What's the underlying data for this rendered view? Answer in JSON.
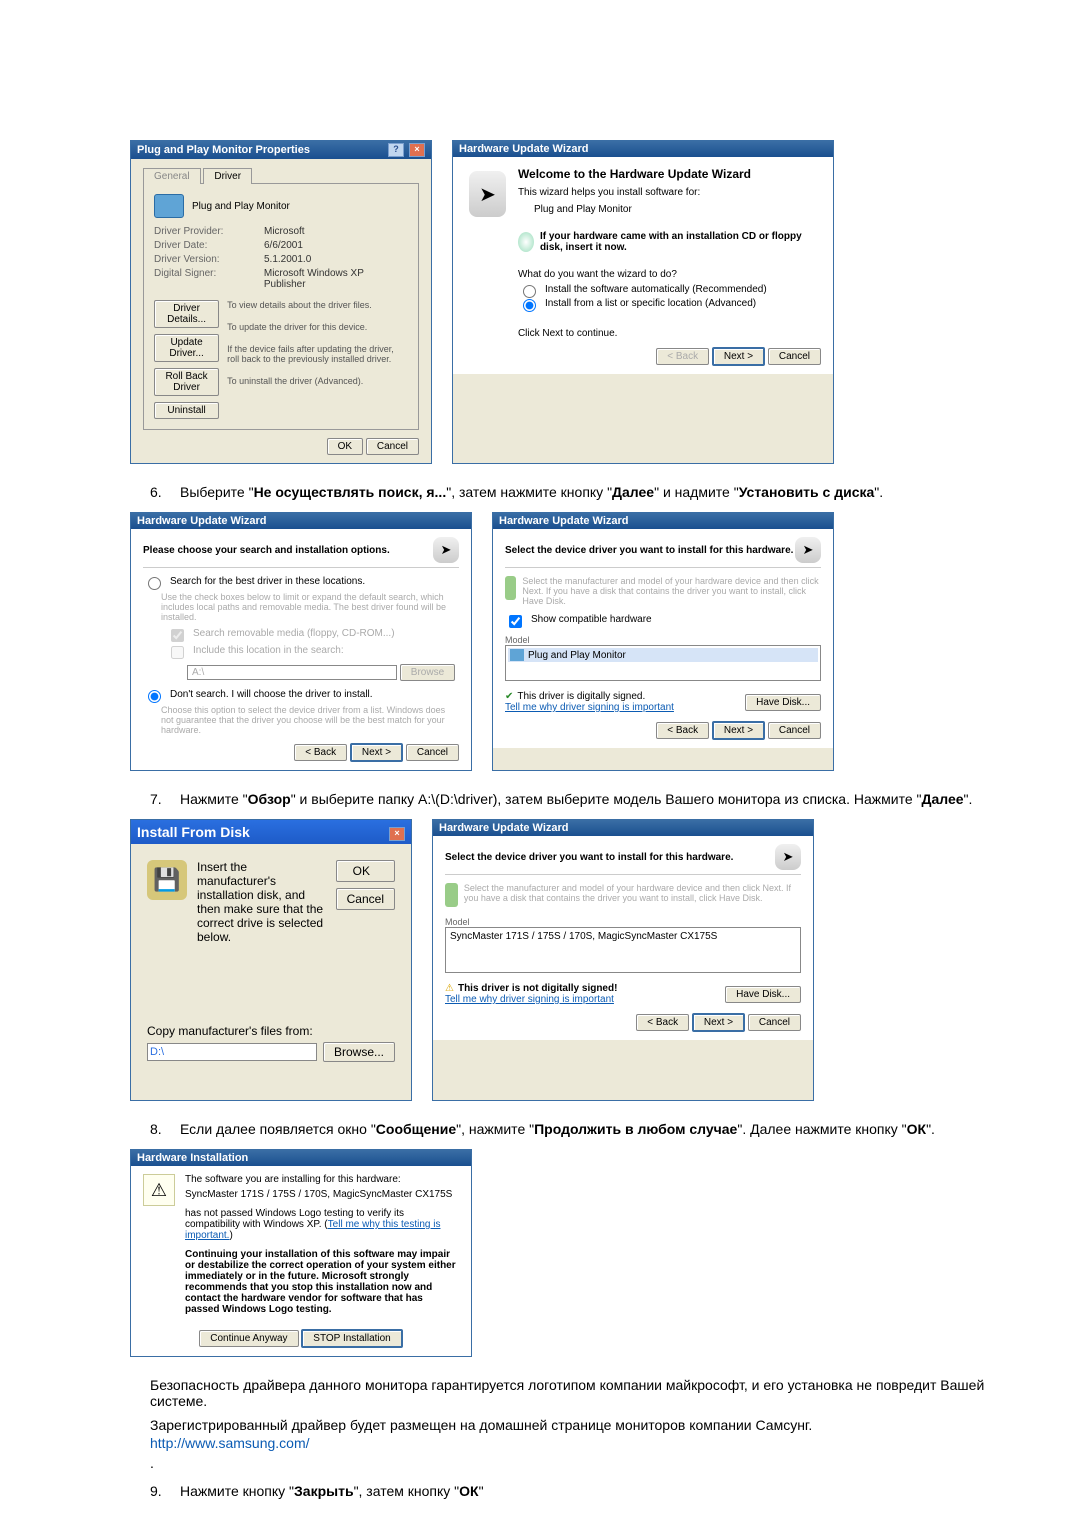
{
  "dialogs": {
    "properties": {
      "title": "Plug and Play Monitor Properties",
      "tab_general": "General",
      "tab_driver": "Driver",
      "device_name": "Plug and Play Monitor",
      "rows": {
        "provider_lbl": "Driver Provider:",
        "provider_val": "Microsoft",
        "date_lbl": "Driver Date:",
        "date_val": "6/6/2001",
        "version_lbl": "Driver Version:",
        "version_val": "5.1.2001.0",
        "signer_lbl": "Digital Signer:",
        "signer_val": "Microsoft Windows XP Publisher"
      },
      "buttons": {
        "details": "Driver Details...",
        "details_info": "To view details about the driver files.",
        "update": "Update Driver...",
        "update_info": "To update the driver for this device.",
        "rollback": "Roll Back Driver",
        "rollback_info": "If the device fails after updating the driver, roll back to the previously installed driver.",
        "uninstall": "Uninstall",
        "uninstall_info": "To uninstall the driver (Advanced)."
      },
      "ok": "OK",
      "cancel": "Cancel"
    },
    "wizard_welcome": {
      "title": "Hardware Update Wizard",
      "heading": "Welcome to the Hardware Update Wizard",
      "intro": "This wizard helps you install software for:",
      "device": "Plug and Play Monitor",
      "cd_hint": "If your hardware came with an installation CD or floppy disk, insert it now.",
      "question": "What do you want the wizard to do?",
      "opt_auto": "Install the software automatically (Recommended)",
      "opt_list": "Install from a list or specific location (Advanced)",
      "next_hint": "Click Next to continue.",
      "back": "< Back",
      "next": "Next >",
      "cancel": "Cancel"
    },
    "wizard_search": {
      "title": "Hardware Update Wizard",
      "heading": "Please choose your search and installation options.",
      "opt_search": "Search for the best driver in these locations.",
      "opt_search_help": "Use the check boxes below to limit or expand the default search, which includes local paths and removable media. The best driver found will be installed.",
      "chk_removable": "Search removable media (floppy, CD-ROM...)",
      "chk_include": "Include this location in the search:",
      "path": "A:\\",
      "browse": "Browse",
      "opt_dont": "Don't search. I will choose the driver to install.",
      "opt_dont_help": "Choose this option to select the device driver from a list. Windows does not guarantee that the driver you choose will be the best match for your hardware.",
      "back": "< Back",
      "next": "Next >",
      "cancel": "Cancel"
    },
    "wizard_select1": {
      "title": "Hardware Update Wizard",
      "heading": "Select the device driver you want to install for this hardware.",
      "help": "Select the manufacturer and model of your hardware device and then click Next. If you have a disk that contains the driver you want to install, click Have Disk.",
      "chk_compat": "Show compatible hardware",
      "col_model": "Model",
      "item": "Plug and Play Monitor",
      "signed": "This driver is digitally signed.",
      "tell": "Tell me why driver signing is important",
      "havedisk": "Have Disk...",
      "back": "< Back",
      "next": "Next >",
      "cancel": "Cancel"
    },
    "install_from_disk": {
      "title": "Install From Disk",
      "text": "Insert the manufacturer's installation disk, and then make sure that the correct drive is selected below.",
      "ok": "OK",
      "cancel": "Cancel",
      "copy_label": "Copy manufacturer's files from:",
      "path": "D:\\",
      "browse": "Browse..."
    },
    "wizard_select2": {
      "title": "Hardware Update Wizard",
      "heading": "Select the device driver you want to install for this hardware.",
      "help": "Select the manufacturer and model of your hardware device and then click Next. If you have a disk that contains the driver you want to install, click Have Disk.",
      "col_model": "Model",
      "item": "SyncMaster 171S / 175S / 170S,  MagicSyncMaster CX175S",
      "notsigned": "This driver is not digitally signed!",
      "tell": "Tell me why driver signing is important",
      "havedisk": "Have Disk...",
      "back": "< Back",
      "next": "Next >",
      "cancel": "Cancel"
    },
    "hardware_installation": {
      "title": "Hardware Installation",
      "line1": "The software you are installing for this hardware:",
      "line2": "SyncMaster 171S / 175S / 170S,  MagicSyncMaster CX175S",
      "line3a": "has not passed Windows Logo testing to verify its compatibility with Windows XP. (",
      "line3_link": "Tell me why this testing is important.",
      "line3b": ")",
      "bold": "Continuing your installation of this software may impair or destabilize the correct operation of your system either immediately or in the future. Microsoft strongly recommends that you stop this installation now and contact the hardware vendor for software that has passed Windows Logo testing.",
      "continue": "Continue Anyway",
      "stop": "STOP Installation"
    }
  },
  "steps": {
    "six_a": "Выберите \"",
    "six_b": "Не осуществлять поиск, я...",
    "six_c": "\", затем нажмите кнопку \"",
    "six_d": "Далее",
    "six_e": "\" и надмите \"",
    "six_f": "Установить с диска",
    "six_g": "\".",
    "seven_a": "Нажмите \"",
    "seven_b": "Обзор",
    "seven_c": "\" и выберите папку A:\\(D:\\driver), затем выберите модель Вашего монитора из списка. Нажмите \"",
    "seven_d": "Далее",
    "seven_e": "\".",
    "eight_a": "Если далее появляется окно \"",
    "eight_b": "Сообщение",
    "eight_c": "\", нажмите \"",
    "eight_d": "Продолжить в любом случае",
    "eight_e": "\". Далее нажмите кнопку \"",
    "eight_f": "ОК",
    "eight_g": "\".",
    "nine_a": "Нажмите кнопку \"",
    "nine_b": "Закрыть",
    "nine_c": "\", затем кнопку \"",
    "nine_d": "ОК",
    "nine_e": "\""
  },
  "footer": {
    "p1": "Безопасность драйвера данного монитора гарантируется логотипом компании майкрософт, и его установка не повредит Вашей системе.",
    "p2": "Зарегистрированный драйвер будет размещен на домашней странице мониторов компании Самсунг.",
    "url": "http://www.samsung.com/"
  }
}
